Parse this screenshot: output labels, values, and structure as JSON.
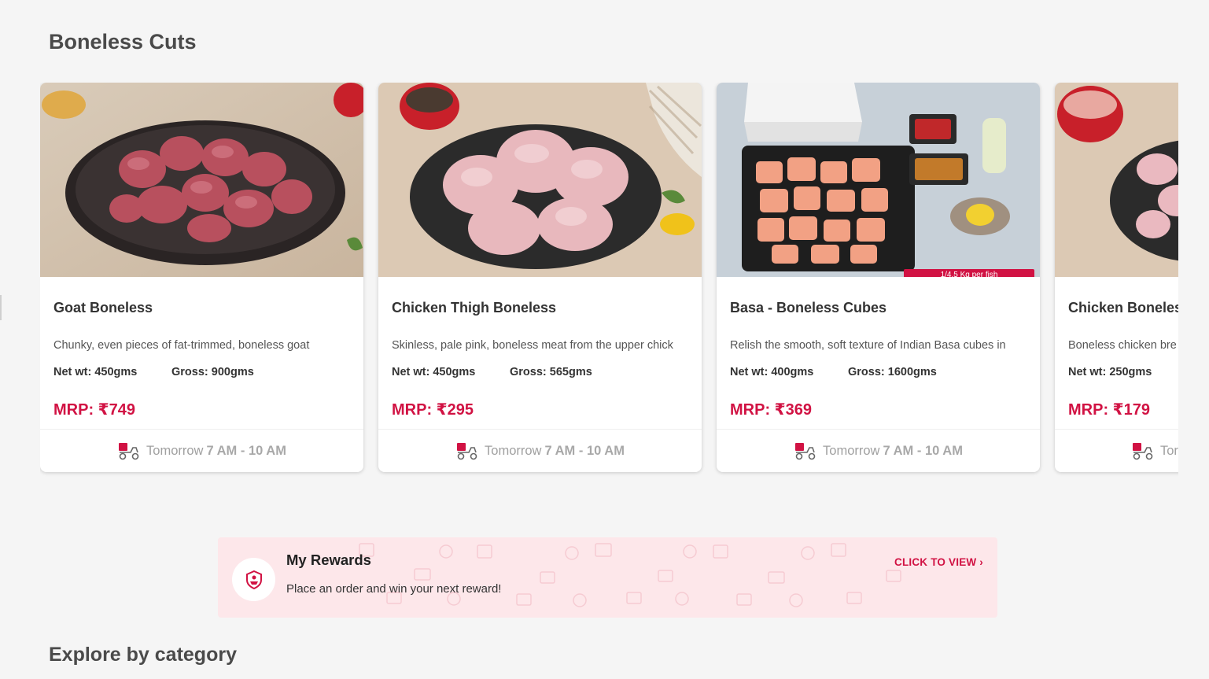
{
  "section": {
    "title": "Boneless Cuts"
  },
  "products": [
    {
      "name": "Goat Boneless",
      "description": "Chunky, even pieces of fat-trimmed, boneless goat",
      "net_wt": "Net wt: 450gms",
      "gross": "Gross: 900gms",
      "price": "MRP: ₹749",
      "delivery_day": "Tomorrow",
      "delivery_slot": "7 AM - 10 AM",
      "badge": ""
    },
    {
      "name": "Chicken Thigh Boneless",
      "description": "Skinless, pale pink, boneless meat from the upper chick",
      "net_wt": "Net wt: 450gms",
      "gross": "Gross: 565gms",
      "price": "MRP: ₹295",
      "delivery_day": "Tomorrow",
      "delivery_slot": "7 AM - 10 AM",
      "badge": ""
    },
    {
      "name": "Basa - Boneless Cubes",
      "description": "Relish the smooth, soft texture of Indian Basa cubes in",
      "net_wt": "Net wt: 400gms",
      "gross": "Gross: 1600gms",
      "price": "MRP: ₹369",
      "delivery_day": "Tomorrow",
      "delivery_slot": "7 AM - 10 AM",
      "badge": "1/4.5 Kg per fish"
    },
    {
      "name": "Chicken Boneless",
      "description": "Boneless chicken bre",
      "net_wt": "Net wt: 250gms",
      "gross": "",
      "price": "MRP: ₹179",
      "delivery_day": "Tor",
      "delivery_slot": "",
      "badge": ""
    }
  ],
  "rewards": {
    "title": "My Rewards",
    "subtitle": "Place an order and win your next reward!",
    "cta": "CLICK TO VIEW ›"
  },
  "explore": {
    "title": "Explore by category"
  },
  "colors": {
    "accent": "#d11243",
    "background": "#f5f5f5",
    "rewards_bg": "#fde7ea"
  },
  "icons": [
    "scooter-delivery-icon",
    "rewards-badge-icon",
    "chevron-right-icon"
  ]
}
